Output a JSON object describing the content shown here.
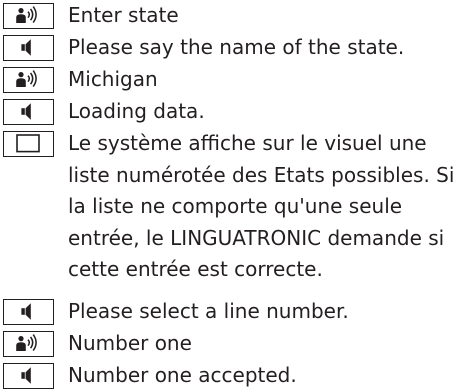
{
  "dialog": {
    "steps": [
      {
        "icon": "voice-command-icon",
        "text": "Enter state"
      },
      {
        "icon": "speaker-icon",
        "text": "Please say the name of the state."
      },
      {
        "icon": "voice-command-icon",
        "text": "Michigan"
      },
      {
        "icon": "speaker-icon",
        "text": "Loading data."
      },
      {
        "icon": "display-icon",
        "text": "Le système affiche sur le visuel une liste numérotée des Etats possibles. Si la liste ne comporte qu'une seule entrée, le LINGUATRONIC demande si cette entrée est correcte."
      },
      {
        "icon": "speaker-icon",
        "text": "Please select a line number."
      },
      {
        "icon": "voice-command-icon",
        "text": "Number one"
      },
      {
        "icon": "speaker-icon",
        "text": "Number one accepted."
      }
    ]
  },
  "colors": {
    "ink": "#231f20",
    "background": "#ffffff"
  }
}
